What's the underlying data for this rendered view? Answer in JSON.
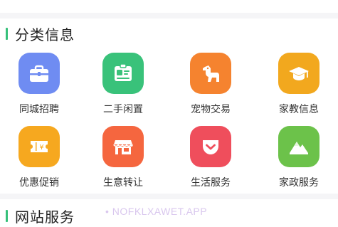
{
  "sections": [
    {
      "title": "分类信息"
    },
    {
      "title": "网站服务"
    }
  ],
  "categories": [
    {
      "label": "同城招聘",
      "icon": "briefcase-icon",
      "color": "#6f8cf2"
    },
    {
      "label": "二手闲置",
      "icon": "id-card-icon",
      "color": "#39c27a"
    },
    {
      "label": "宠物交易",
      "icon": "dog-icon",
      "color": "#f5832f"
    },
    {
      "label": "家教信息",
      "icon": "graduation-cap-icon",
      "color": "#f2a81e"
    },
    {
      "label": "优惠促销",
      "icon": "coupon-icon",
      "color": "#f6a81f"
    },
    {
      "label": "生意转让",
      "icon": "storefront-icon",
      "color": "#f5663f"
    },
    {
      "label": "生活服务",
      "icon": "pocket-icon",
      "color": "#ef4e5c"
    },
    {
      "label": "家政服务",
      "icon": "mountain-icon",
      "color": "#6cc24a"
    }
  ],
  "watermark": "• NOFKLXAWET.APP"
}
